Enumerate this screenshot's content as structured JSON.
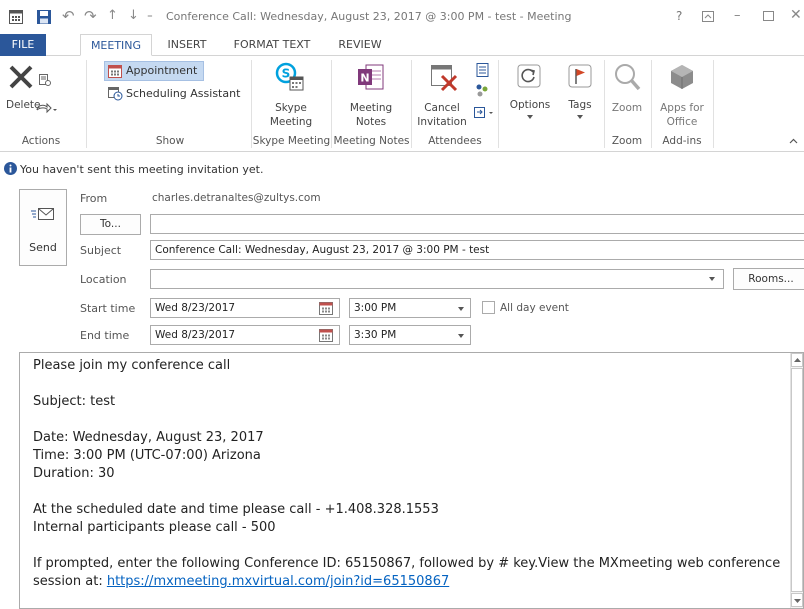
{
  "window": {
    "title": "Conference Call: Wednesday, August 23, 2017 @ 3:00 PM - test - Meeting",
    "help": "?"
  },
  "tabs": [
    "FILE",
    "MEETING",
    "INSERT",
    "FORMAT TEXT",
    "REVIEW"
  ],
  "ribbon": {
    "actions": {
      "delete": "Delete",
      "group": "Actions"
    },
    "show": {
      "appointment": "Appointment",
      "scheduling": "Scheduling Assistant",
      "group": "Show"
    },
    "skype": {
      "label1": "Skype",
      "label2": "Meeting",
      "group": "Skype Meeting"
    },
    "notes": {
      "label1": "Meeting",
      "label2": "Notes",
      "group": "Meeting Notes"
    },
    "attendees": {
      "cancel1": "Cancel",
      "cancel2": "Invitation",
      "group": "Attendees"
    },
    "options": {
      "label": "Options"
    },
    "tags": {
      "label": "Tags"
    },
    "zoom": {
      "label": "Zoom",
      "group": "Zoom"
    },
    "apps": {
      "label1": "Apps for",
      "label2": "Office",
      "group": "Add-ins"
    }
  },
  "info_bar": "You haven't sent this meeting invitation yet.",
  "form": {
    "send": "Send",
    "from_label": "From",
    "from_value": "charles.detranaltes@zultys.com",
    "to_button": "To...",
    "to_value": "",
    "subject_label": "Subject",
    "subject_value": "Conference Call: Wednesday, August 23, 2017 @ 3:00 PM - test",
    "location_label": "Location",
    "location_value": "",
    "rooms_button": "Rooms...",
    "start_label": "Start time",
    "start_date": "Wed 8/23/2017",
    "start_time": "3:00 PM",
    "allday_label": "All day event",
    "allday_checked": false,
    "end_label": "End time",
    "end_date": "Wed 8/23/2017",
    "end_time": "3:30 PM"
  },
  "body": {
    "l1": "Please join my conference call",
    "l2": "Subject: test",
    "l3": "Date: Wednesday, August 23, 2017",
    "l4": "Time: 3:00 PM (UTC-07:00) Arizona",
    "l5": "Duration: 30",
    "l6": "At the scheduled date and time please call - +1.408.328.1553",
    "l7": "Internal participants please call - 500",
    "l8": "If prompted, enter the following Conference ID: 65150867, followed by # key.View the MXmeeting web conference",
    "l9_prefix": "session at: ",
    "l9_link": "https://mxmeeting.mxvirtual.com/join?id=65150867"
  },
  "colors": {
    "accent": "#2b579a",
    "link": "#0563c1",
    "info": "#2b579a"
  }
}
